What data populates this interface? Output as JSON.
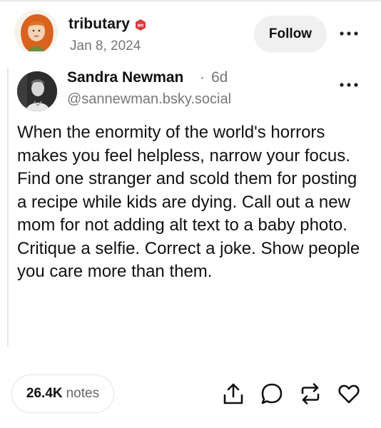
{
  "post": {
    "author": "tributary",
    "date": "Jan 8, 2024",
    "follow_label": "Follow",
    "badge_text": "8ft"
  },
  "quoted": {
    "name": "Sandra Newman",
    "separator": "·",
    "time": "6d",
    "handle": "@sannewman.bsky.social",
    "body": "When the enormity of the world's horrors makes you feel helpless, narrow your focus. Find one stranger and scold them for posting a recipe while kids are dying. Call out a new mom for not adding alt text to a baby photo. Critique a selfie. Correct a joke. Show people you care more than them."
  },
  "footer": {
    "notes_count": "26.4K",
    "notes_label": "notes",
    "actions": [
      "share-icon",
      "reply-icon",
      "reblog-icon",
      "like-icon"
    ]
  },
  "colors": {
    "text": "#111111",
    "secondary": "#777777",
    "follow_bg": "#f0f0f0",
    "badge": "#d93a3a",
    "hair": "#d8621e"
  }
}
